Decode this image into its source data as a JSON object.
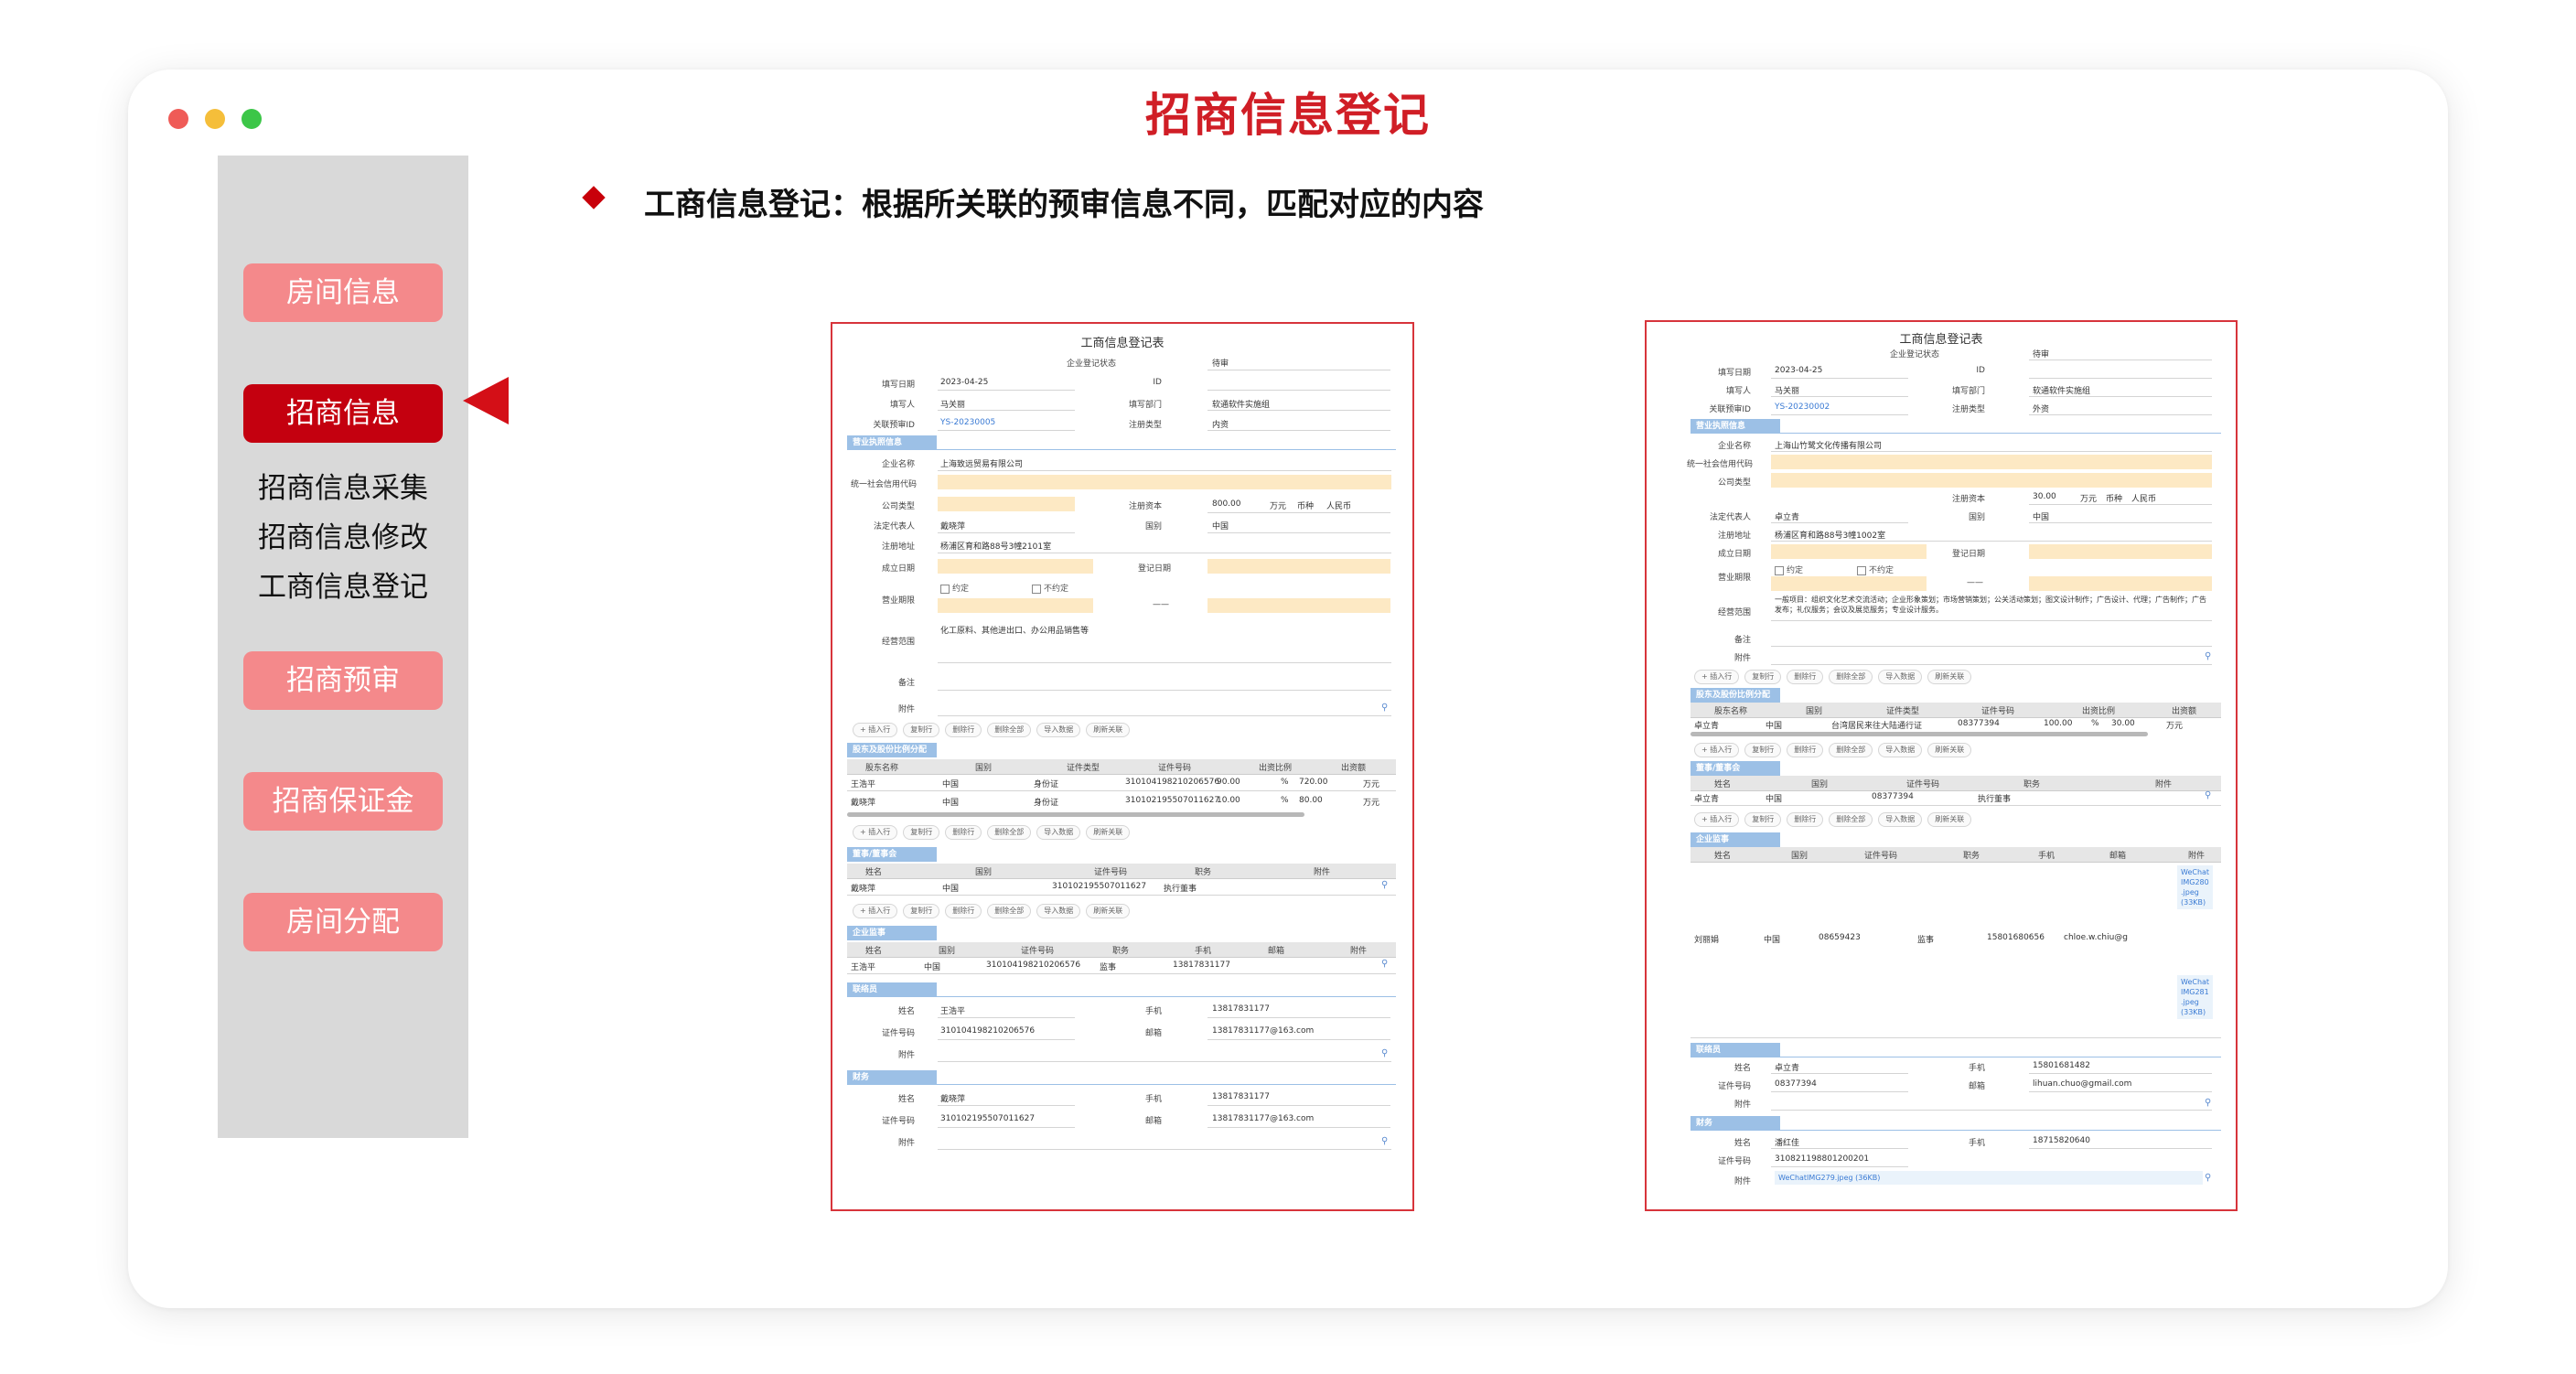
{
  "window": {
    "title": "招商信息登记",
    "subtitle": "工商信息登记：根据所关联的预审信息不同，匹配对应的内容"
  },
  "sidebar": {
    "items": [
      {
        "label": "房间信息",
        "active": false
      },
      {
        "label": "招商信息",
        "active": true
      },
      {
        "label": "招商预审",
        "active": false
      },
      {
        "label": "招商保证金",
        "active": false
      },
      {
        "label": "房间分配",
        "active": false
      }
    ],
    "subitems": [
      "招商信息采集",
      "招商信息修改",
      "工商信息登记"
    ]
  },
  "colors": {
    "accent": "#d01e26",
    "nav_inactive": "#f4898b",
    "nav_active": "#c4000f",
    "sidebar_bg": "#d9d9d9",
    "section_header": "#9cc0e6",
    "input_highlight": "#fde9c4"
  },
  "buttons": {
    "insert": "+ 插入行",
    "copy": "复制行",
    "delete": "删除行",
    "delete_all": "删除全部",
    "import": "导入数据",
    "refresh": "刷新关联"
  },
  "form1": {
    "title": "工商信息登记表",
    "fields": {
      "status_label": "企业登记状态",
      "status_value": "待审",
      "date_label": "填写日期",
      "date_value": "2023-04-25",
      "id_label": "ID",
      "filler_label": "填写人",
      "filler_value": "马关丽",
      "dept_label": "填写部门",
      "dept_value": "软通软件实施组",
      "ref_label": "关联预审ID",
      "ref_value": "YS-20230005",
      "regtype_label": "注册类型",
      "regtype_value": "内资"
    },
    "sections": {
      "business": "营业执照信息",
      "shareholders": "股东及股份比例分配",
      "board": "董事/董事会",
      "supervisor": "企业监事",
      "contact": "联络员",
      "finance": "财务"
    },
    "business": {
      "company_label": "企业名称",
      "company_value": "上海致远贸易有限公司",
      "credit_label": "统一社会信用代码",
      "type_label": "公司类型",
      "capital_label": "注册资本",
      "capital_value": "800.00",
      "capital_unit": "万元",
      "currency_label": "币种",
      "currency_value": "人民币",
      "rep_label": "法定代表人",
      "rep_value": "戴晓萍",
      "country_label": "国别",
      "country_value": "中国",
      "address_label": "注册地址",
      "address_value": "杨浦区育和路88号3幢2101室",
      "founded_label": "成立日期",
      "regdate_label": "登记日期",
      "term_label": "营业期限",
      "term_fixed": "约定",
      "term_unlimited": "不约定",
      "term_sep": "——",
      "scope_label": "经营范围",
      "scope_value": "化工原料、其他进出口、办公用品销售等",
      "remark_label": "备注",
      "attach_label": "附件"
    },
    "shareholders": {
      "headers": [
        "股东名称",
        "国别",
        "证件类型",
        "证件号码",
        "出资比例",
        "出资额"
      ],
      "rows": [
        {
          "name": "王浩平",
          "country": "中国",
          "idtype": "身份证",
          "idno": "310104198210206576",
          "ratio": "90.00",
          "unit": "%",
          "amount": "720.00",
          "amount_unit": "万元"
        },
        {
          "name": "戴晓萍",
          "country": "中国",
          "idtype": "身份证",
          "idno": "310102195507011627",
          "ratio": "10.00",
          "unit": "%",
          "amount": "80.00",
          "amount_unit": "万元"
        }
      ]
    },
    "board": {
      "headers": [
        "姓名",
        "国别",
        "证件号码",
        "职务",
        "附件"
      ],
      "row": {
        "name": "戴晓萍",
        "country": "中国",
        "idno": "310102195507011627",
        "role": "执行董事"
      }
    },
    "supervisor": {
      "headers": [
        "姓名",
        "国别",
        "证件号码",
        "职务",
        "手机",
        "邮箱",
        "附件"
      ],
      "row": {
        "name": "王浩平",
        "country": "中国",
        "idno": "310104198210206576",
        "role": "监事",
        "phone": "13817831177"
      }
    },
    "contact": {
      "name_label": "姓名",
      "name_value": "王浩平",
      "phone_label": "手机",
      "phone_value": "13817831177",
      "id_label": "证件号码",
      "id_value": "310104198210206576",
      "email_label": "邮箱",
      "email_value": "13817831177@163.com",
      "attach_label": "附件"
    },
    "finance": {
      "name_label": "姓名",
      "name_value": "戴晓萍",
      "phone_label": "手机",
      "phone_value": "13817831177",
      "id_label": "证件号码",
      "id_value": "310102195507011627",
      "email_label": "邮箱",
      "email_value": "13817831177@163.com",
      "attach_label": "附件"
    }
  },
  "form2": {
    "title": "工商信息登记表",
    "fields": {
      "status_label": "企业登记状态",
      "status_value": "待审",
      "date_label": "填写日期",
      "date_value": "2023-04-25",
      "id_label": "ID",
      "filler_label": "填写人",
      "filler_value": "马关丽",
      "dept_label": "填写部门",
      "dept_value": "软通软件实施组",
      "ref_label": "关联预审ID",
      "ref_value": "YS-20230002",
      "regtype_label": "注册类型",
      "regtype_value": "外资"
    },
    "sections": {
      "business": "营业执照信息",
      "shareholders": "股东及股份比例分配",
      "board": "董事/董事会",
      "supervisor": "企业监事",
      "contact": "联络员",
      "finance": "财务"
    },
    "business": {
      "company_label": "企业名称",
      "company_value": "上海山竹鹭文化传播有限公司",
      "credit_label": "统一社会信用代码",
      "type_label": "公司类型",
      "capital_label": "注册资本",
      "capital_value": "30.00",
      "capital_unit": "万元",
      "currency_label": "币种",
      "currency_value": "人民币",
      "rep_label": "法定代表人",
      "rep_value": "卓立青",
      "country_label": "国别",
      "country_value": "中国",
      "address_label": "注册地址",
      "address_value": "杨浦区育和路88号3幢1002室",
      "founded_label": "成立日期",
      "regdate_label": "登记日期",
      "term_label": "营业期限",
      "term_fixed": "约定",
      "term_unlimited": "不约定",
      "term_sep": "——",
      "scope_label": "经营范围",
      "scope_value": "一般项目：组织文化艺术交流活动；企业形象策划；市场营销策划；公关活动策划；图文设计制作；广告设计、代理；广告制作；广告发布；礼仪服务；会议及展览服务；专业设计服务。",
      "remark_label": "备注",
      "attach_label": "附件"
    },
    "shareholders": {
      "headers": [
        "股东名称",
        "国别",
        "证件类型",
        "证件号码",
        "出资比例",
        "出资额"
      ],
      "row": {
        "name": "卓立青",
        "country": "中国",
        "idtype": "台湾居民来往大陆通行证",
        "idno": "08377394",
        "ratio": "100.00",
        "unit": "%",
        "amount": "30.00",
        "amount_unit": "万元"
      }
    },
    "board": {
      "headers": [
        "姓名",
        "国别",
        "证件号码",
        "职务",
        "附件"
      ],
      "row": {
        "name": "卓立青",
        "country": "中国",
        "idno": "08377394",
        "role": "执行董事"
      }
    },
    "supervisor": {
      "headers": [
        "姓名",
        "国别",
        "证件号码",
        "职务",
        "手机",
        "邮箱",
        "附件"
      ],
      "row": {
        "name": "刘丽娟",
        "country": "中国",
        "idno": "08659423",
        "role": "监事",
        "phone": "15801680656",
        "email": "chloe.w.chiu@g"
      },
      "files": [
        "WeChat\nIMG280\n.jpeg\n(33KB)",
        "WeChat\nIMG281\n.jpeg\n(33KB)"
      ]
    },
    "contact": {
      "name_label": "姓名",
      "name_value": "卓立青",
      "phone_label": "手机",
      "phone_value": "15801681482",
      "id_label": "证件号码",
      "id_value": "08377394",
      "email_label": "邮箱",
      "email_value": "lihuan.chuo@gmail.com",
      "attach_label": "附件"
    },
    "finance": {
      "name_label": "姓名",
      "name_value": "潘红佳",
      "phone_label": "手机",
      "phone_value": "18715820640",
      "id_label": "证件号码",
      "id_value": "310821198801200201",
      "attach_label": "附件",
      "file": "WeChatIMG279.jpeg (36KB)"
    }
  }
}
